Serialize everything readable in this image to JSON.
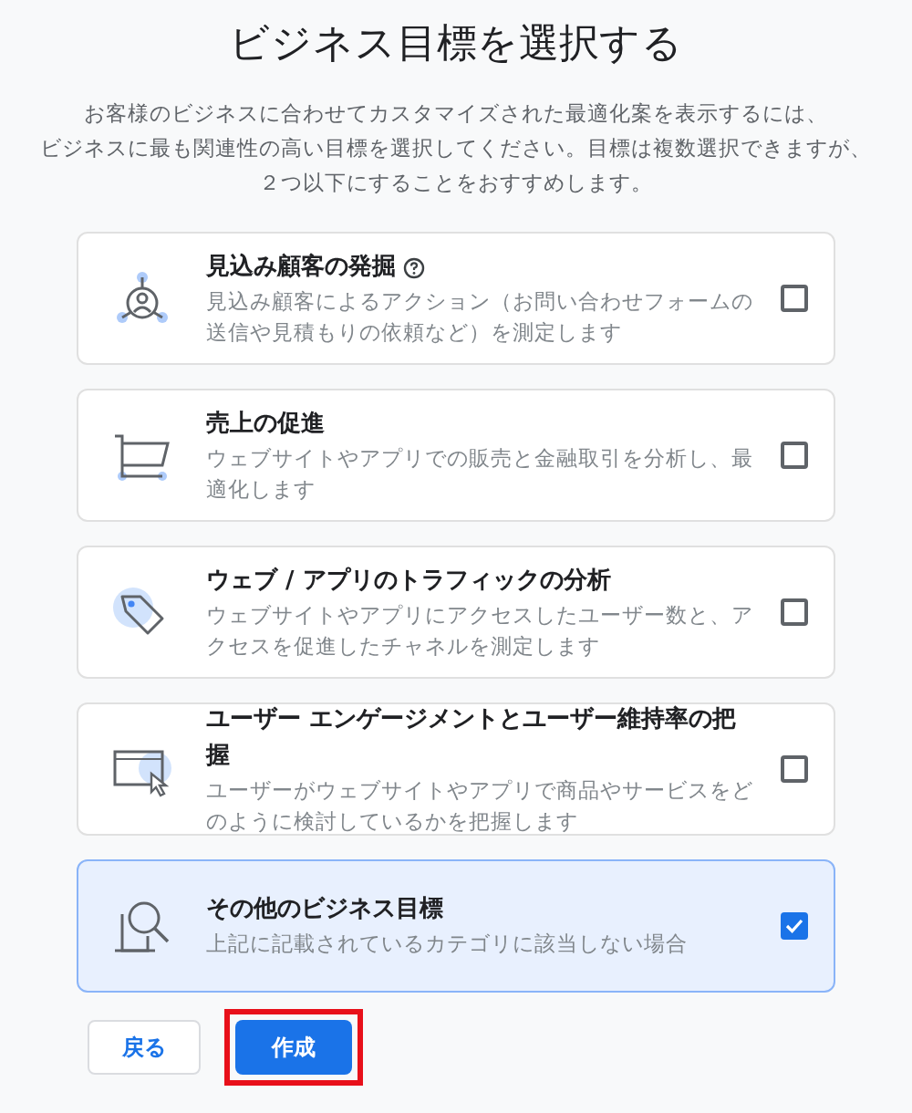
{
  "title": "ビジネス目標を選択する",
  "intro": [
    "お客様のビジネスに合わせてカスタマイズされた最適化案を表示するには、",
    "ビジネスに最も関連性の高い目標を選択してください。目標は複数選択できますが、",
    "２つ以下にすることをおすすめします。"
  ],
  "goals": [
    {
      "kind": "leads",
      "title": "見込み顧客の発掘",
      "help": true,
      "description": "見込み顧客によるアクション（お問い合わせフォームの送信や見積もりの依頼など）を測定します",
      "selected": false
    },
    {
      "kind": "sales",
      "title": "売上の促進",
      "help": false,
      "description": "ウェブサイトやアプリでの販売と金融取引を分析し、最適化します",
      "selected": false
    },
    {
      "kind": "traffic",
      "title": "ウェブ / アプリのトラフィックの分析",
      "help": false,
      "description": "ウェブサイトやアプリにアクセスしたユーザー数と、アクセスを促進したチャネルを測定します",
      "selected": false
    },
    {
      "kind": "engagement",
      "title": "ユーザー エンゲージメントとユーザー維持率の把握",
      "help": false,
      "description": "ユーザーがウェブサイトやアプリで商品やサービスをどのように検討しているかを把握します",
      "selected": false
    },
    {
      "kind": "other",
      "title": "その他のビジネス目標",
      "help": false,
      "description": "上記に記載されているカテゴリに該当しない場合",
      "selected": true
    }
  ],
  "buttons": [
    {
      "kind": "secondary",
      "label": "戻る",
      "highlighted": false
    },
    {
      "kind": "primary",
      "label": "作成",
      "highlighted": true
    }
  ]
}
